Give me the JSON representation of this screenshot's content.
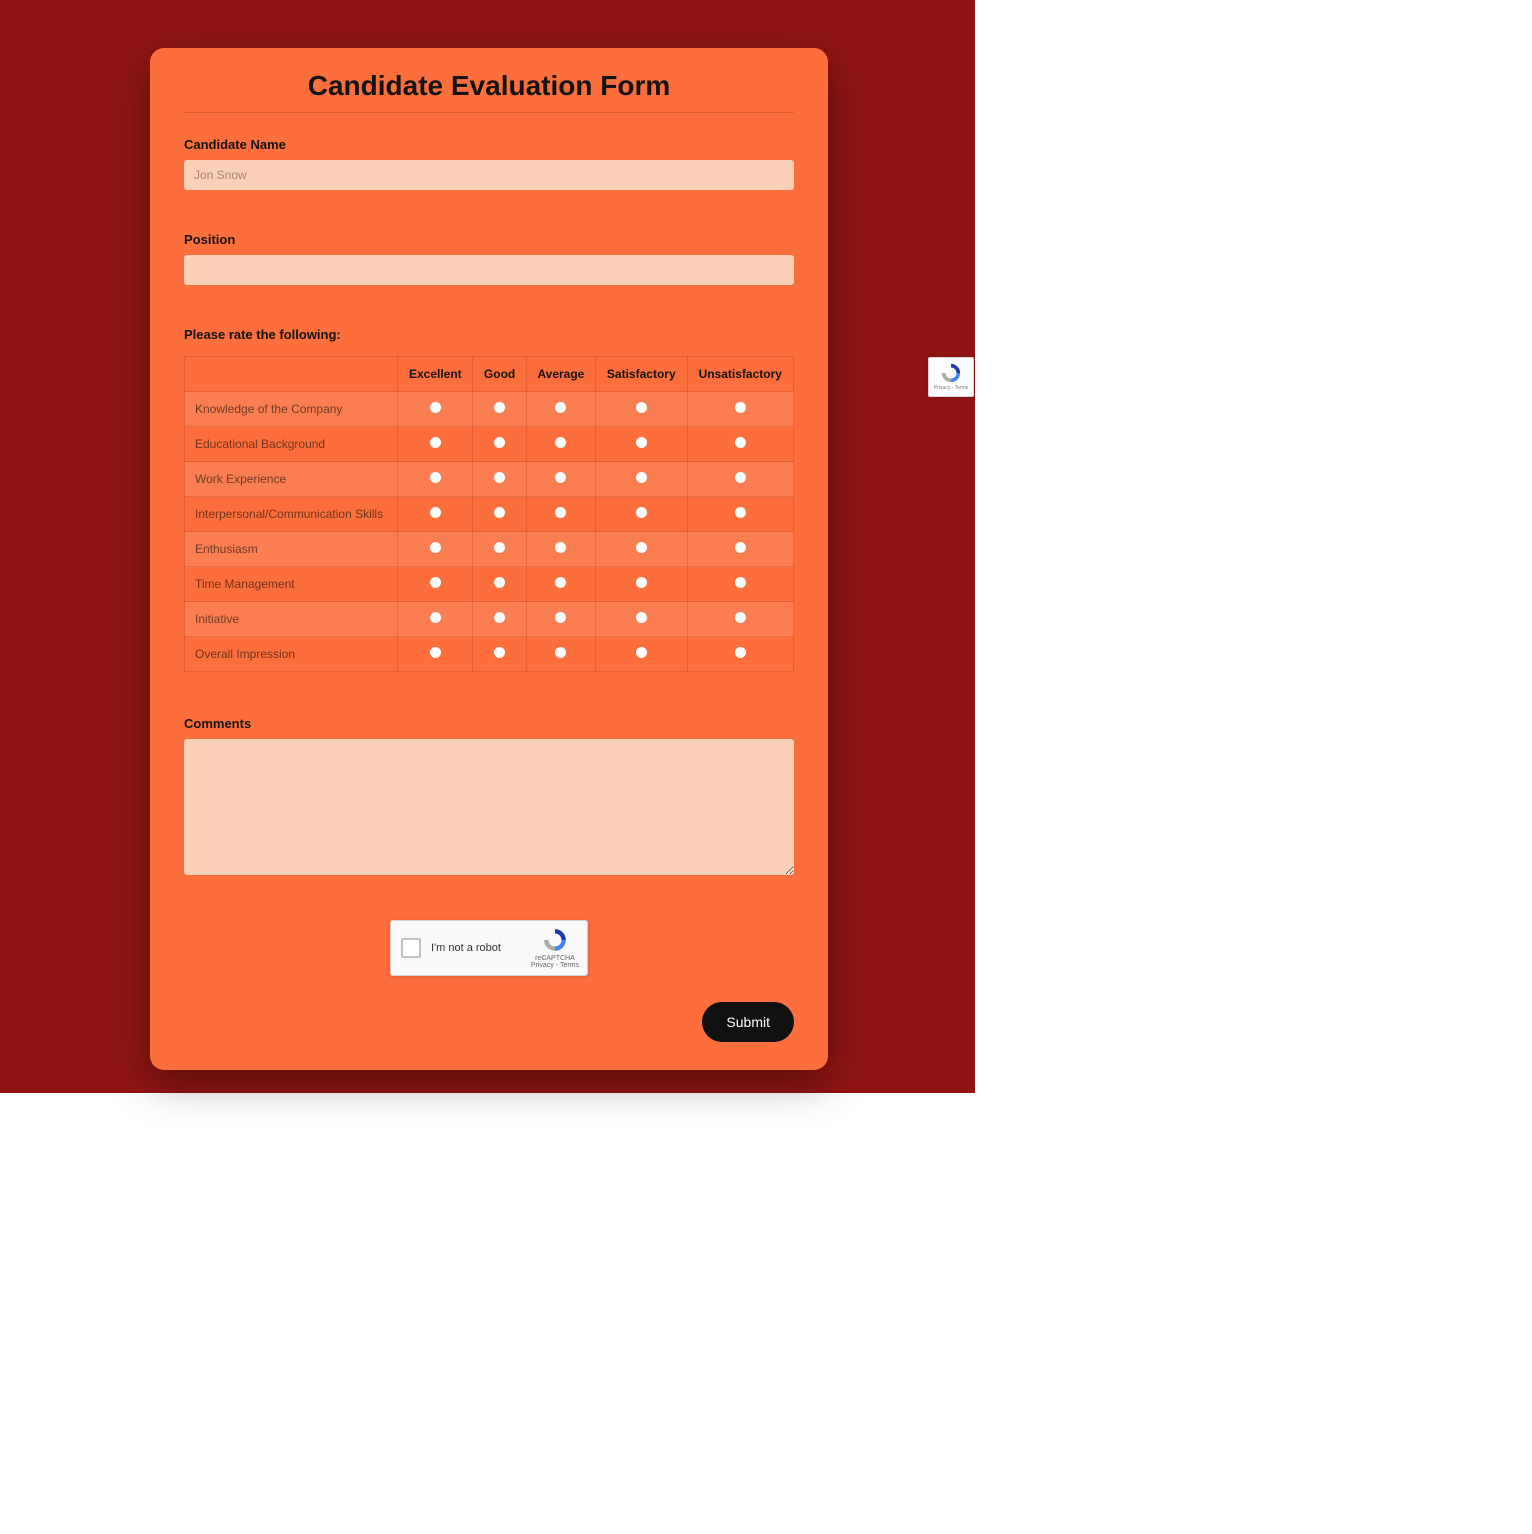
{
  "form": {
    "title": "Candidate Evaluation Form",
    "candidate_name_label": "Candidate Name",
    "candidate_name_placeholder": "Jon Snow",
    "candidate_name_value": "",
    "position_label": "Position",
    "position_value": "",
    "rate_prompt": "Please rate the following:",
    "rating_headers": [
      "",
      "Excellent",
      "Good",
      "Average",
      "Satisfactory",
      "Unsatisfactory"
    ],
    "criteria": [
      "Knowledge of the Company",
      "Educational Background",
      "Work Experience",
      "Interpersonal/Communication Skills",
      "Enthusiasm",
      "Time Management",
      "Initiative",
      "Overall Impression"
    ],
    "comments_label": "Comments",
    "comments_value": "",
    "submit_label": "Submit"
  },
  "captcha": {
    "not_robot_label": "I'm not a robot",
    "brand": "reCAPTCHA",
    "privacy": "Privacy",
    "terms": "Terms"
  }
}
